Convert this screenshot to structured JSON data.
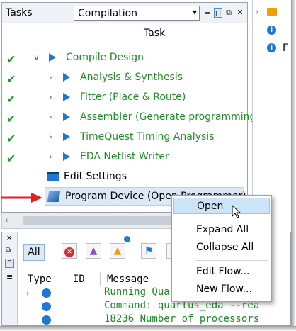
{
  "tasks": {
    "title": "Tasks",
    "flow_value": "Compilation",
    "column_header": "Task",
    "rows": [
      {
        "label": "Compile Design",
        "status": "done"
      },
      {
        "label": "Analysis & Synthesis",
        "status": "done"
      },
      {
        "label": "Fitter (Place & Route)",
        "status": "done"
      },
      {
        "label": "Assembler (Generate programming",
        "status": "done"
      },
      {
        "label": "TimeQuest Timing Analysis",
        "status": "done"
      },
      {
        "label": "EDA Netlist Writer",
        "status": "done"
      }
    ],
    "edit_settings": "Edit Settings",
    "program_device": "Program Device (Open Programmer)"
  },
  "right_panel": {
    "partial_text": "F"
  },
  "messages": {
    "all_label": "All",
    "columns": [
      "Type",
      "ID",
      "Message"
    ],
    "lines": [
      "Running Quartus Prime EDA",
      "Command: quartus_eda --rea",
      "18236 Number of processors"
    ],
    "line_colors": [
      "#1f8d26",
      "#1f8d26",
      "#1f8d26"
    ]
  },
  "context_menu": {
    "items": [
      "Open",
      "Expand All",
      "Collapse All",
      "Edit Flow...",
      "New Flow..."
    ],
    "highlighted": "Open"
  },
  "colors": {
    "accent": "#1e78d2",
    "success": "#1f9a2c",
    "arrow": "#e02020"
  }
}
